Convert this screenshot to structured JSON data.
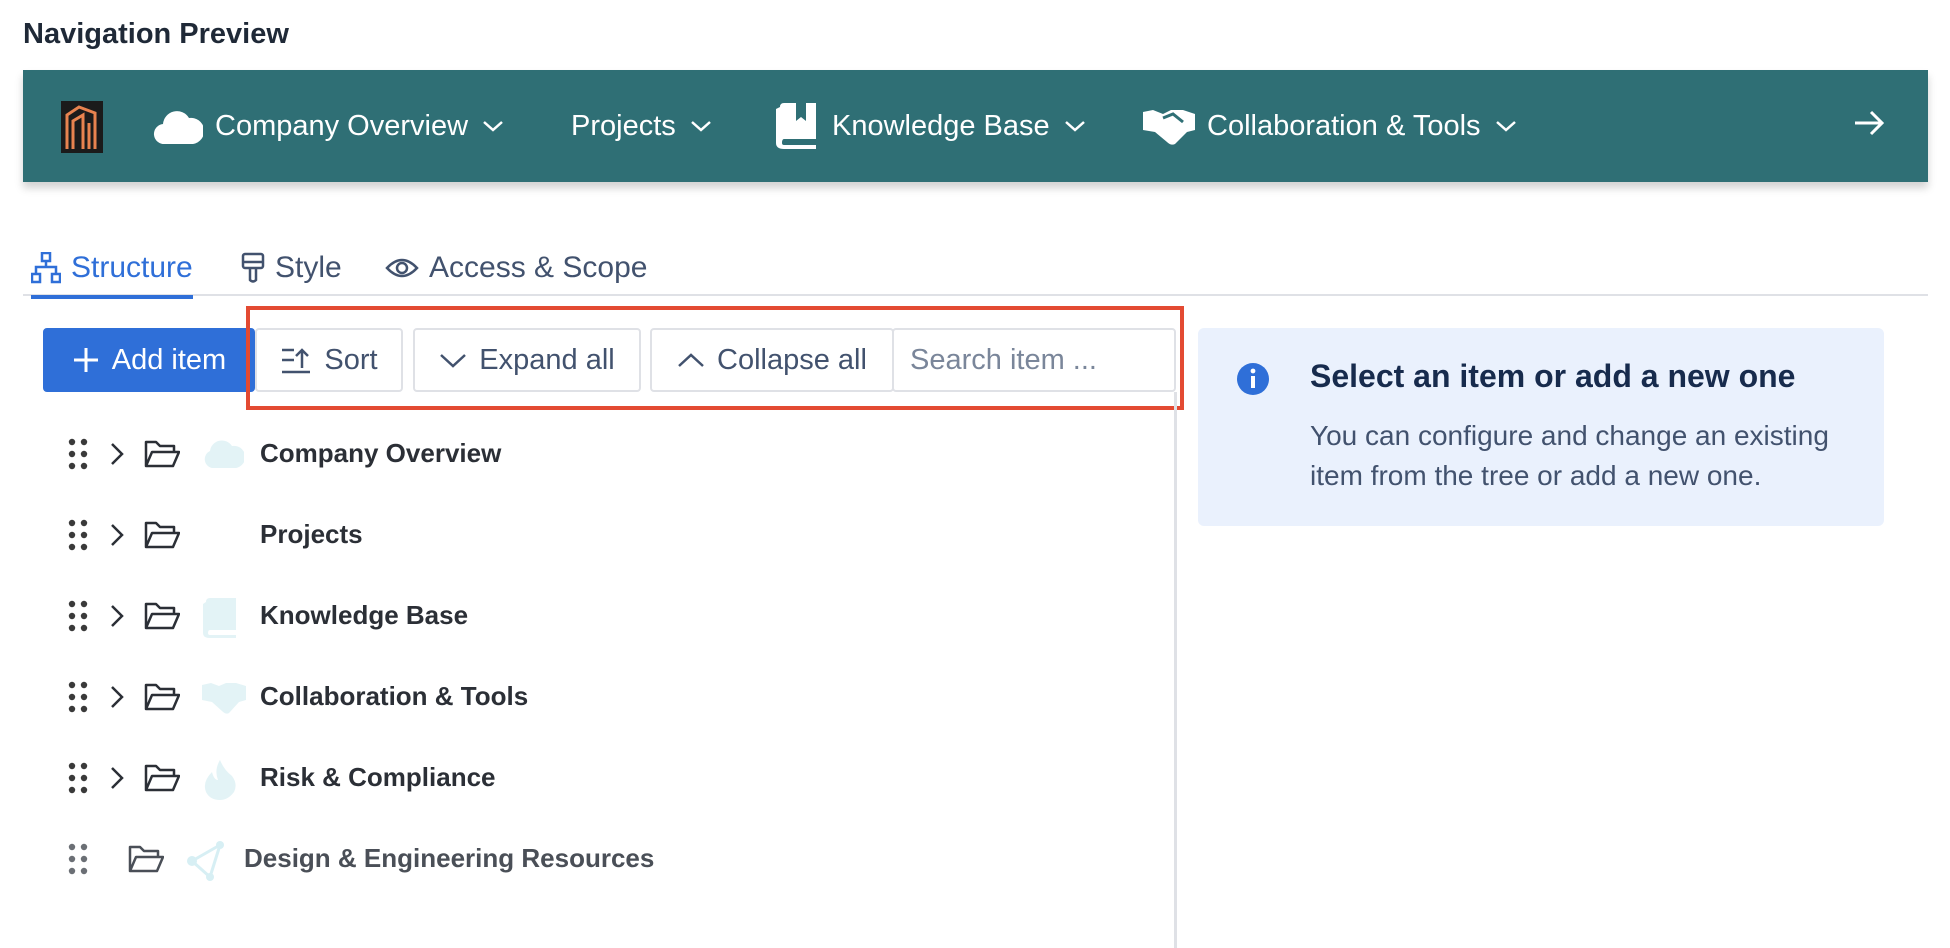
{
  "preview": {
    "title": "Navigation Preview"
  },
  "navbar": {
    "background_color": "#2f6f75",
    "items": [
      {
        "label": "Company Overview",
        "icon": "cloud-icon"
      },
      {
        "label": "Projects",
        "icon": ""
      },
      {
        "label": "Knowledge Base",
        "icon": "book-icon"
      },
      {
        "label": "Collaboration & Tools",
        "icon": "handshake-icon"
      }
    ],
    "arrow_icon": "arrow-right-icon"
  },
  "tabs": [
    {
      "label": "Structure",
      "icon": "sitemap-icon",
      "active": true
    },
    {
      "label": "Style",
      "icon": "paint-brush-icon",
      "active": false
    },
    {
      "label": "Access & Scope",
      "icon": "eye-icon",
      "active": false
    }
  ],
  "toolbar": {
    "add_label": "Add item",
    "sort_label": "Sort",
    "expand_label": "Expand all",
    "collapse_label": "Collapse all",
    "search_placeholder": "Search item ...",
    "primary_color": "#2f6fd8",
    "highlight_color": "#e34a32"
  },
  "tree": [
    {
      "label": "Company Overview",
      "icon": "cloud-icon",
      "expandable": true
    },
    {
      "label": "Projects",
      "icon": "",
      "expandable": true
    },
    {
      "label": "Knowledge Base",
      "icon": "book-icon",
      "expandable": true
    },
    {
      "label": "Collaboration & Tools",
      "icon": "handshake-icon",
      "expandable": true
    },
    {
      "label": "Risk & Compliance",
      "icon": "fire-icon",
      "expandable": true
    },
    {
      "label": "Design & Engineering Resources",
      "icon": "share-nodes-icon",
      "expandable": false
    }
  ],
  "info": {
    "title": "Select an item or add a new one",
    "text": "You can configure and change an existing item from the tree or add a new one.",
    "icon": "info-icon",
    "background_color": "#eaf1fd"
  }
}
